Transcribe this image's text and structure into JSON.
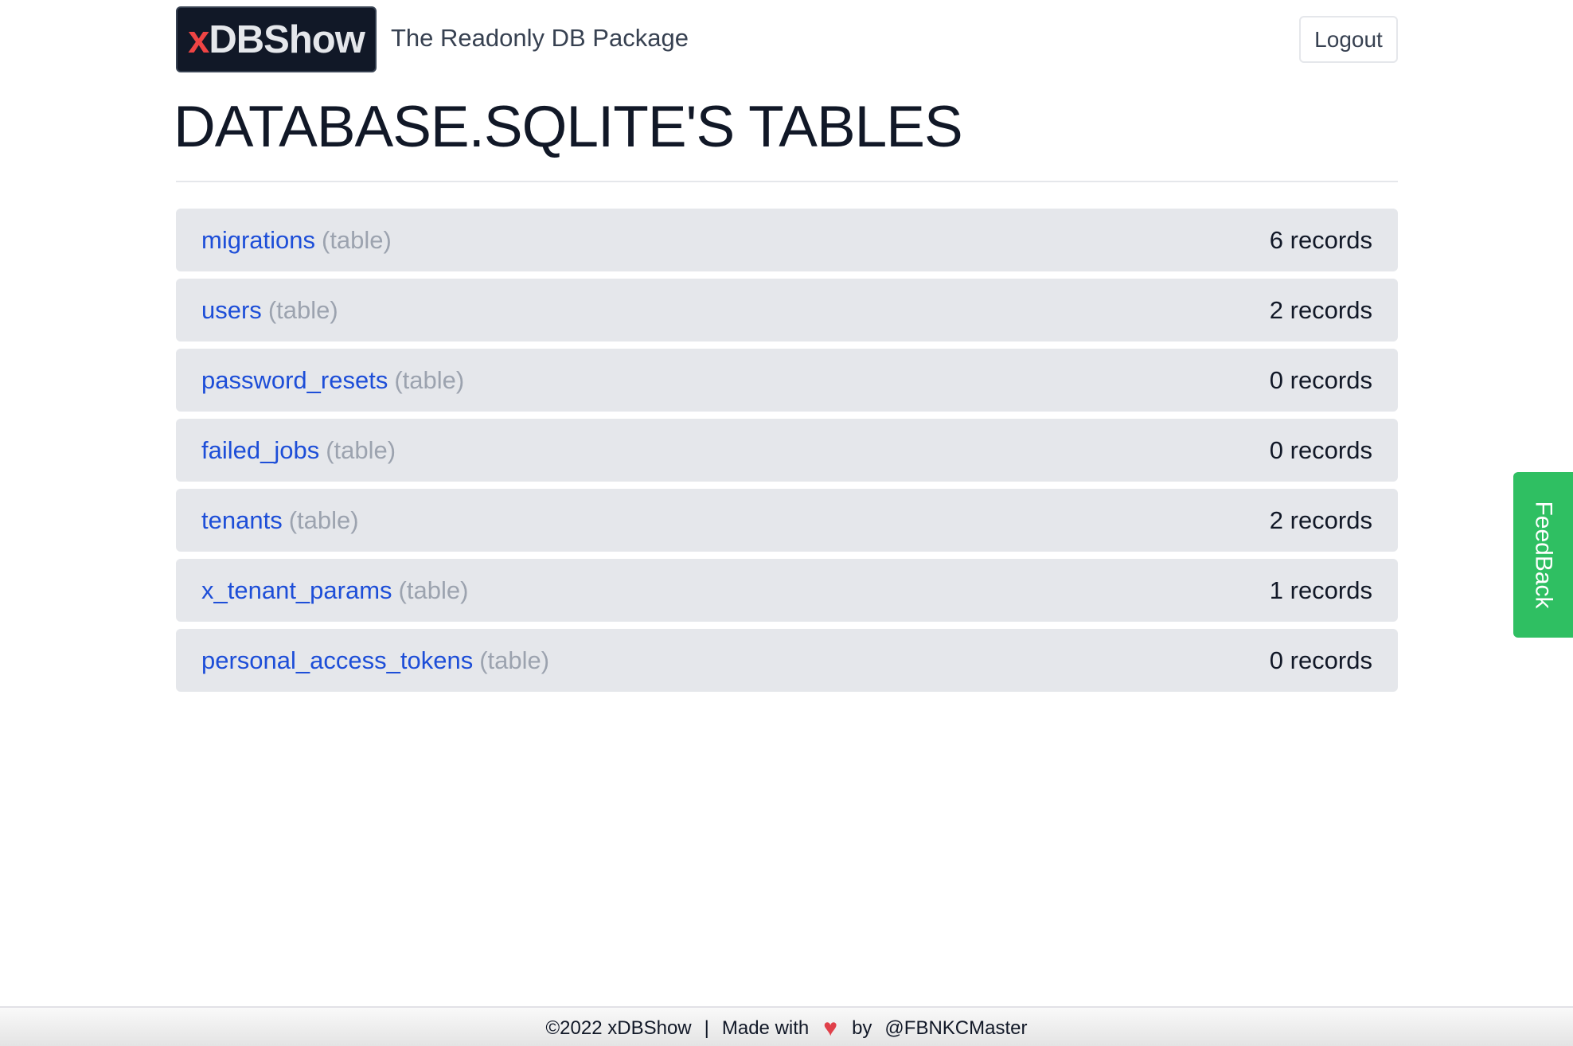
{
  "header": {
    "logo_prefix": "x",
    "logo_rest": "DBShow",
    "tagline": "The Readonly DB Package",
    "logout_label": "Logout"
  },
  "page": {
    "title": "DATABASE.SQLITE'S TABLES"
  },
  "tables": [
    {
      "name": "migrations",
      "type": "(table)",
      "count": "6 records"
    },
    {
      "name": "users",
      "type": "(table)",
      "count": "2 records"
    },
    {
      "name": "password_resets",
      "type": "(table)",
      "count": "0 records"
    },
    {
      "name": "failed_jobs",
      "type": "(table)",
      "count": "0 records"
    },
    {
      "name": "tenants",
      "type": "(table)",
      "count": "2 records"
    },
    {
      "name": "x_tenant_params",
      "type": "(table)",
      "count": "1 records"
    },
    {
      "name": "personal_access_tokens",
      "type": "(table)",
      "count": "0 records"
    }
  ],
  "feedback": {
    "label": "FeedBack",
    "color": "#2fbf62"
  },
  "footer": {
    "copyright": "©2022 xDBShow",
    "separator": "|",
    "made_with": "Made with",
    "heart_icon": "♥",
    "by": "by",
    "author": "@FBNKCMaster"
  },
  "colors": {
    "link": "#1d4ed8",
    "muted": "#9ca3af",
    "row_bg": "#e5e7eb",
    "logo_accent": "#ef4444"
  }
}
